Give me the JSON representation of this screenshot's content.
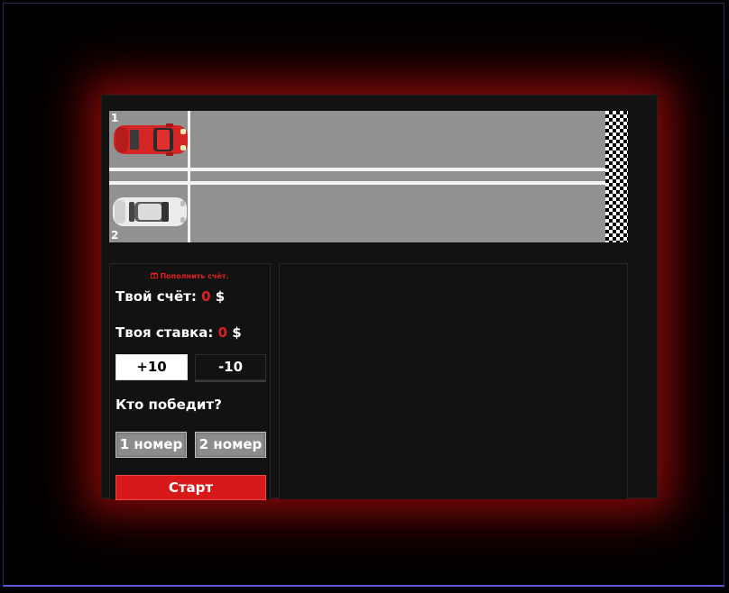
{
  "track": {
    "lane1_number": "1",
    "lane2_number": "2",
    "cars": [
      {
        "lane": 1,
        "color": "#d42525",
        "icon": "red-car-icon"
      },
      {
        "lane": 2,
        "color": "#e6e6e6",
        "icon": "white-car-icon"
      }
    ]
  },
  "panel": {
    "topup_label": "Пополнить счёт.",
    "balance_label": "Твой счёт:",
    "balance_value": "0",
    "balance_currency": "$",
    "bet_label": "Твоя ставка:",
    "bet_value": "0",
    "bet_currency": "$",
    "plus_label": "+10",
    "minus_label": "-10",
    "question": "Кто победит?",
    "car1_label": "1 номер",
    "car2_label": "2 номер",
    "start_label": "Старт"
  },
  "colors": {
    "accent": "#d7191a",
    "background": "#121212",
    "glow": "#c81010"
  }
}
